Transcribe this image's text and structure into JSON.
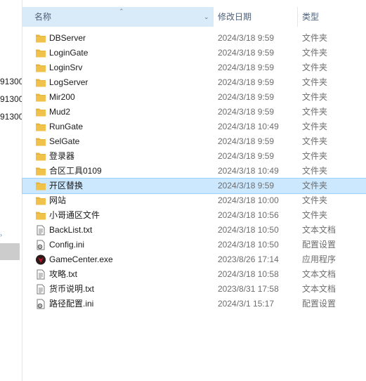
{
  "header": {
    "name": "名称",
    "date": "修改日期",
    "type": "类型"
  },
  "left_pane": {
    "fragments": [
      "91300",
      "91300",
      "91300"
    ]
  },
  "files": [
    {
      "name": "DBServer",
      "date": "2024/3/18 9:59",
      "type": "文件夹",
      "icon": "folder-icon"
    },
    {
      "name": "LoginGate",
      "date": "2024/3/18 9:59",
      "type": "文件夹",
      "icon": "folder-icon"
    },
    {
      "name": "LoginSrv",
      "date": "2024/3/18 9:59",
      "type": "文件夹",
      "icon": "folder-icon"
    },
    {
      "name": "LogServer",
      "date": "2024/3/18 9:59",
      "type": "文件夹",
      "icon": "folder-icon"
    },
    {
      "name": "Mir200",
      "date": "2024/3/18 9:59",
      "type": "文件夹",
      "icon": "folder-icon"
    },
    {
      "name": "Mud2",
      "date": "2024/3/18 9:59",
      "type": "文件夹",
      "icon": "folder-icon"
    },
    {
      "name": "RunGate",
      "date": "2024/3/18 10:49",
      "type": "文件夹",
      "icon": "folder-icon"
    },
    {
      "name": "SelGate",
      "date": "2024/3/18 9:59",
      "type": "文件夹",
      "icon": "folder-icon"
    },
    {
      "name": "登录器",
      "date": "2024/3/18 9:59",
      "type": "文件夹",
      "icon": "folder-icon"
    },
    {
      "name": "合区工具0109",
      "date": "2024/3/18 10:49",
      "type": "文件夹",
      "icon": "folder-icon"
    },
    {
      "name": "开区替换",
      "date": "2024/3/18 9:59",
      "type": "文件夹",
      "icon": "folder-icon",
      "selected": true
    },
    {
      "name": "网站",
      "date": "2024/3/18 10:00",
      "type": "文件夹",
      "icon": "folder-icon"
    },
    {
      "name": "小哥通区文件",
      "date": "2024/3/18 10:56",
      "type": "文件夹",
      "icon": "folder-icon"
    },
    {
      "name": "BackList.txt",
      "date": "2024/3/18 10:50",
      "type": "文本文档",
      "icon": "text-file-icon"
    },
    {
      "name": "Config.ini",
      "date": "2024/3/18 10:50",
      "type": "配置设置",
      "icon": "config-file-icon"
    },
    {
      "name": "GameCenter.exe",
      "date": "2023/8/26 17:14",
      "type": "应用程序",
      "icon": "app-icon"
    },
    {
      "name": "攻略.txt",
      "date": "2024/3/18 10:58",
      "type": "文本文档",
      "icon": "text-file-icon"
    },
    {
      "name": "货币说明.txt",
      "date": "2023/8/31 17:58",
      "type": "文本文档",
      "icon": "text-file-icon"
    },
    {
      "name": "路径配置.ini",
      "date": "2024/3/1 15:17",
      "type": "配置设置",
      "icon": "config-file-icon"
    }
  ],
  "colors": {
    "folder": "#f0c24b",
    "selection": "#cce8ff",
    "header_active": "#d9ebf9",
    "app_red": "#c8102e"
  }
}
